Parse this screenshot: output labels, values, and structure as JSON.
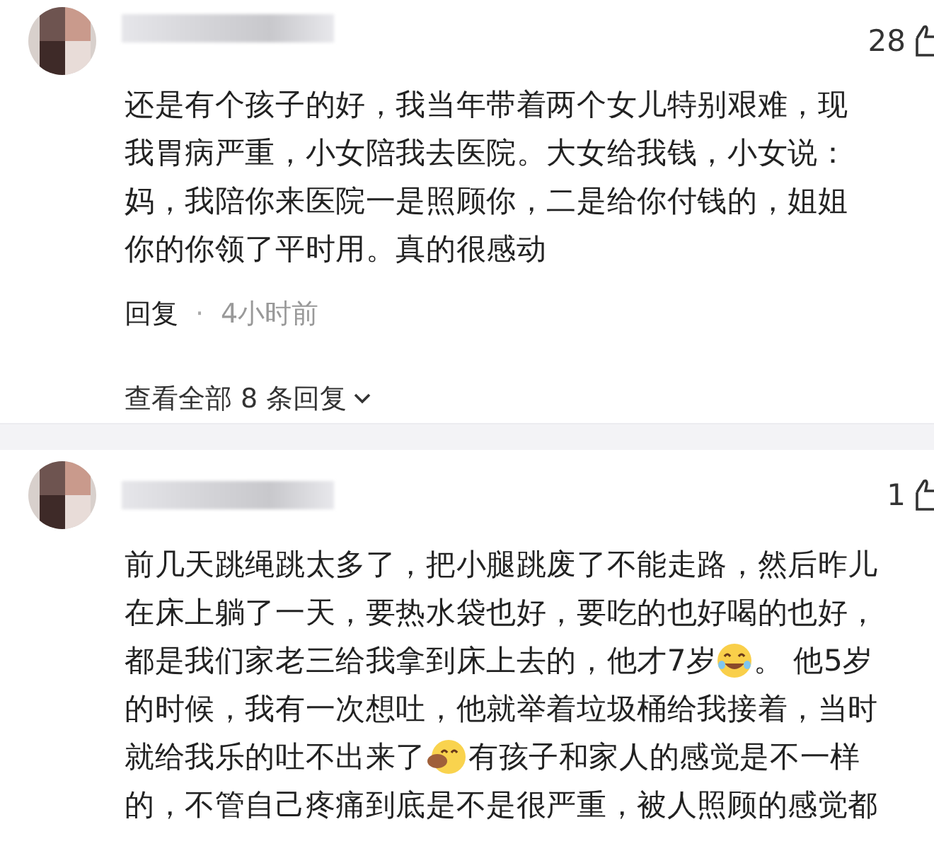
{
  "comments": [
    {
      "likes": "28",
      "lines": [
        [
          {
            "kind": "text",
            "text": "还是有个孩子的好，我当年带着两个女儿特别艰难，现"
          }
        ],
        [
          {
            "kind": "text",
            "text": "我胃病严重，小女陪我去医院。大女给我钱，小女说："
          }
        ],
        [
          {
            "kind": "text",
            "text": "妈，我陪你来医院一是照顾你，二是给你付钱的，姐姐"
          }
        ],
        [
          {
            "kind": "text",
            "text": "你的你领了平时用。真的很感动"
          }
        ]
      ],
      "reply_label": "回复",
      "separator": "·",
      "time": "4小时前",
      "view_replies": "查看全部 8 条回复"
    },
    {
      "likes": "1",
      "lines": [
        [
          {
            "kind": "text",
            "text": "前几天跳绳跳太多了，把小腿跳废了不能走路，然后昨儿"
          }
        ],
        [
          {
            "kind": "text",
            "text": "在床上躺了一天，要热水袋也好，要吃的也好喝的也好，"
          }
        ],
        [
          {
            "kind": "text",
            "text": "都是我们家老三给我拿到床上去的，他才7岁"
          },
          {
            "kind": "laughing"
          },
          {
            "kind": "text",
            "text": "。 他5岁"
          }
        ],
        [
          {
            "kind": "text",
            "text": "的时候，我有一次想吐，他就举着垃圾桶给我接着，当时"
          }
        ],
        [
          {
            "kind": "text",
            "text": "就给我乐的吐不出来了"
          },
          {
            "kind": "blushing"
          },
          {
            "kind": "text",
            "text": " 有孩子和家人的感觉是不一样"
          }
        ],
        [
          {
            "kind": "text",
            "text": "的，不管自己疼痛到底是不是很严重，被人照顾的感觉都"
          }
        ]
      ]
    }
  ]
}
